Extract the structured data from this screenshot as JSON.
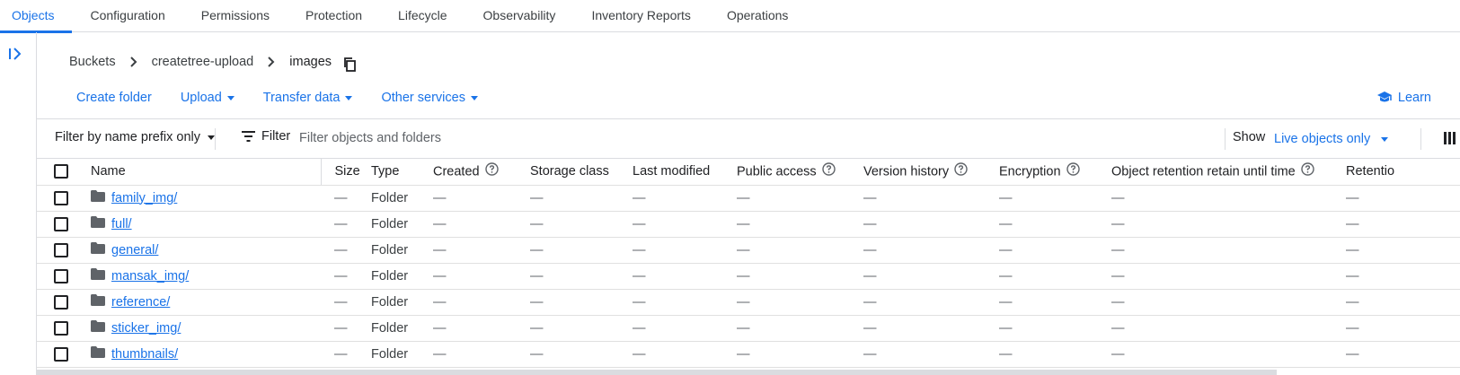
{
  "tabs": [
    {
      "label": "Objects",
      "active": true
    },
    {
      "label": "Configuration"
    },
    {
      "label": "Permissions"
    },
    {
      "label": "Protection"
    },
    {
      "label": "Lifecycle"
    },
    {
      "label": "Observability"
    },
    {
      "label": "Inventory Reports"
    },
    {
      "label": "Operations"
    }
  ],
  "breadcrumb": {
    "root": "Buckets",
    "bucket": "createtree-upload",
    "current": "images"
  },
  "actions": {
    "create_folder": "Create folder",
    "upload": "Upload",
    "transfer_data": "Transfer data",
    "other_services": "Other services",
    "learn": "Learn"
  },
  "filter": {
    "prefix_mode": "Filter by name prefix only",
    "filter_label": "Filter",
    "placeholder": "Filter objects and folders",
    "show_label": "Show",
    "show_value": "Live objects only"
  },
  "table": {
    "columns": [
      "Name",
      "Size",
      "Type",
      "Created",
      "Storage class",
      "Last modified",
      "Public access",
      "Version history",
      "Encryption",
      "Object retention retain until time",
      "Retentio"
    ],
    "rows": [
      {
        "name": "family_img/",
        "size": "—",
        "type": "Folder",
        "created": "—",
        "storage_class": "—",
        "last_modified": "—",
        "public_access": "—",
        "version_history": "—",
        "encryption": "—",
        "retain_until": "—",
        "retention": "—"
      },
      {
        "name": "full/",
        "size": "—",
        "type": "Folder",
        "created": "—",
        "storage_class": "—",
        "last_modified": "—",
        "public_access": "—",
        "version_history": "—",
        "encryption": "—",
        "retain_until": "—",
        "retention": "—"
      },
      {
        "name": "general/",
        "size": "—",
        "type": "Folder",
        "created": "—",
        "storage_class": "—",
        "last_modified": "—",
        "public_access": "—",
        "version_history": "—",
        "encryption": "—",
        "retain_until": "—",
        "retention": "—"
      },
      {
        "name": "mansak_img/",
        "size": "—",
        "type": "Folder",
        "created": "—",
        "storage_class": "—",
        "last_modified": "—",
        "public_access": "—",
        "version_history": "—",
        "encryption": "—",
        "retain_until": "—",
        "retention": "—"
      },
      {
        "name": "reference/",
        "size": "—",
        "type": "Folder",
        "created": "—",
        "storage_class": "—",
        "last_modified": "—",
        "public_access": "—",
        "version_history": "—",
        "encryption": "—",
        "retain_until": "—",
        "retention": "—"
      },
      {
        "name": "sticker_img/",
        "size": "—",
        "type": "Folder",
        "created": "—",
        "storage_class": "—",
        "last_modified": "—",
        "public_access": "—",
        "version_history": "—",
        "encryption": "—",
        "retain_until": "—",
        "retention": "—"
      },
      {
        "name": "thumbnails/",
        "size": "—",
        "type": "Folder",
        "created": "—",
        "storage_class": "—",
        "last_modified": "—",
        "public_access": "—",
        "version_history": "—",
        "encryption": "—",
        "retain_until": "—",
        "retention": "—"
      }
    ]
  },
  "colors": {
    "accent": "#1a73e8",
    "border": "#dadce0",
    "text": "#202124",
    "muted": "#5f6368"
  },
  "icons": [
    "sidebar-expand-icon",
    "chevron-right-icon",
    "copy-icon",
    "graduation-cap-icon",
    "filter-lines-icon",
    "column-display-icon",
    "help-circle-icon",
    "folder-icon"
  ]
}
